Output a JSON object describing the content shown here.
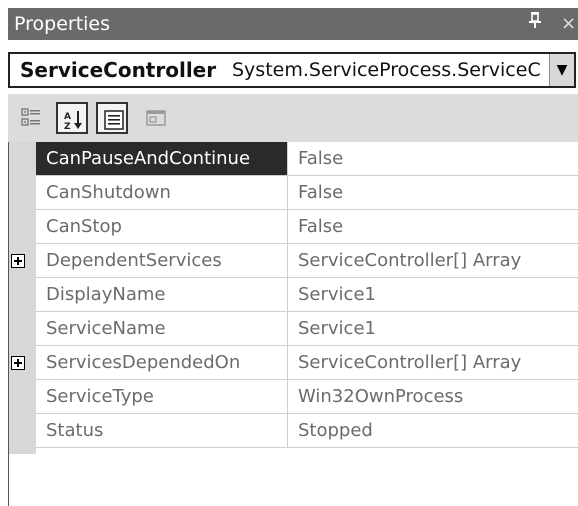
{
  "window": {
    "title": "Properties",
    "pin_glyph": "&#x1F4CC;",
    "close_glyph": "×"
  },
  "selector": {
    "object_name": "ServiceController",
    "object_type": "System.ServiceProcess.ServiceC",
    "dropdown_glyph": "▼"
  },
  "toolbar": {
    "buttons": [
      "categorized-icon",
      "alphabetical-icon",
      "properties-icon",
      "property-pages-icon"
    ],
    "alphabetical_pressed": true,
    "properties_pressed": true
  },
  "grid": {
    "rows": [
      {
        "name": "CanPauseAndContinue",
        "value": "False",
        "expandable": false,
        "selected": true
      },
      {
        "name": "CanShutdown",
        "value": "False",
        "expandable": false,
        "selected": false
      },
      {
        "name": "CanStop",
        "value": "False",
        "expandable": false,
        "selected": false
      },
      {
        "name": "DependentServices",
        "value": "ServiceController[] Array",
        "expandable": true,
        "selected": false
      },
      {
        "name": "DisplayName",
        "value": "Service1",
        "expandable": false,
        "selected": false
      },
      {
        "name": "ServiceName",
        "value": "Service1",
        "expandable": false,
        "selected": false
      },
      {
        "name": "ServicesDependedOn",
        "value": "ServiceController[] Array",
        "expandable": true,
        "selected": false
      },
      {
        "name": "ServiceType",
        "value": "Win32OwnProcess",
        "expandable": false,
        "selected": false
      },
      {
        "name": "Status",
        "value": "Stopped",
        "expandable": false,
        "selected": false
      }
    ]
  },
  "colors": {
    "titlebar": "#6a6a6a",
    "toolbar": "#dcdcdc",
    "selection": "#2a2a2a",
    "gutter": "#d7d7d7"
  }
}
